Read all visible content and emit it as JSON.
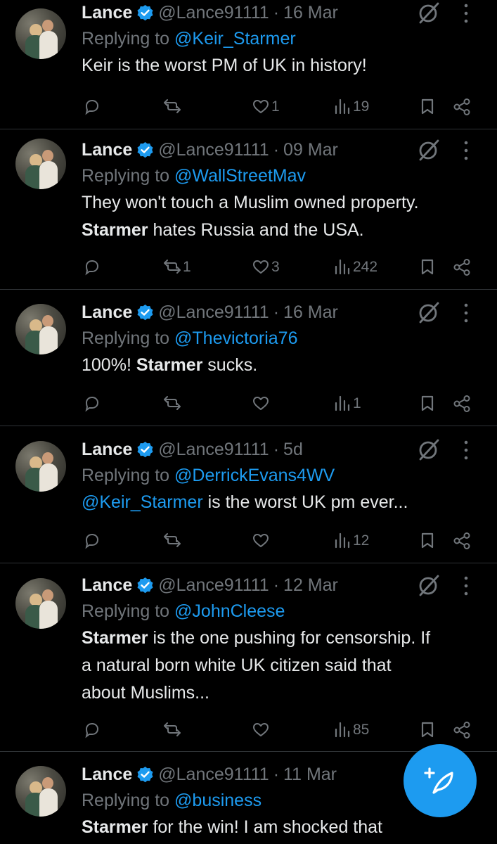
{
  "tweets": [
    {
      "name": "Lance",
      "handle": "@Lance91111",
      "sep": "·",
      "time": "16 Mar",
      "reply_prefix": "Replying to",
      "reply_to": "@Keir_Starmer",
      "text": [
        {
          "t": "Keir is the worst PM of UK in history!",
          "b": false
        }
      ],
      "reply_count": "",
      "retweets": "",
      "likes": "1",
      "views": "19"
    },
    {
      "name": "Lance",
      "handle": "@Lance91111",
      "sep": "·",
      "time": "09 Mar",
      "reply_prefix": "Replying to",
      "reply_to": "@WallStreetMav",
      "text": [
        {
          "t": "They won't touch a Muslim owned property.\n",
          "b": false
        },
        {
          "t": "Starmer",
          "b": true
        },
        {
          "t": " hates Russia and the USA.",
          "b": false
        }
      ],
      "reply_count": "",
      "retweets": "1",
      "likes": "3",
      "views": "242"
    },
    {
      "name": "Lance",
      "handle": "@Lance91111",
      "sep": "·",
      "time": "16 Mar",
      "reply_prefix": "Replying to",
      "reply_to": "@Thevictoria76",
      "text": [
        {
          "t": "100%! ",
          "b": false
        },
        {
          "t": "Starmer",
          "b": true
        },
        {
          "t": " sucks.",
          "b": false
        }
      ],
      "reply_count": "",
      "retweets": "",
      "likes": "",
      "views": "1"
    },
    {
      "name": "Lance",
      "handle": "@Lance91111",
      "sep": "·",
      "time": "5d",
      "reply_prefix": "Replying to",
      "reply_to": "@DerrickEvans4WV",
      "text": [
        {
          "t": "@Keir_Starmer",
          "b": false,
          "m": true
        },
        {
          "t": " is the worst UK pm ever...",
          "b": false
        }
      ],
      "reply_count": "",
      "retweets": "",
      "likes": "",
      "views": "12"
    },
    {
      "name": "Lance",
      "handle": "@Lance91111",
      "sep": "·",
      "time": "12 Mar",
      "reply_prefix": "Replying to",
      "reply_to": "@JohnCleese",
      "text": [
        {
          "t": "Starmer",
          "b": true
        },
        {
          "t": " is the one pushing for censorship. If\na natural born white UK citizen said that\nabout Muslims...",
          "b": false
        }
      ],
      "reply_count": "",
      "retweets": "",
      "likes": "",
      "views": "85"
    },
    {
      "name": "Lance",
      "handle": "@Lance91111",
      "sep": "·",
      "time": "11 Mar",
      "reply_prefix": "Replying to",
      "reply_to": "@business",
      "text": [
        {
          "t": "Starmer",
          "b": true
        },
        {
          "t": " for the win! I am shocked that",
          "b": false
        }
      ],
      "reply_count": "",
      "retweets": "",
      "likes": "",
      "views": ""
    }
  ],
  "icons": {
    "verified": "verified-badge-icon",
    "grok": "grok-icon",
    "more": "more-options-icon",
    "reply": "reply-icon",
    "retweet": "retweet-icon",
    "like": "like-icon",
    "views": "views-icon",
    "bookmark": "bookmark-icon",
    "share": "share-icon",
    "compose": "compose-post-icon"
  },
  "colors": {
    "background": "#000000",
    "text": "#e7e9ea",
    "muted": "#71767b",
    "accent": "#1d9bf0",
    "divider": "#2f3336"
  }
}
